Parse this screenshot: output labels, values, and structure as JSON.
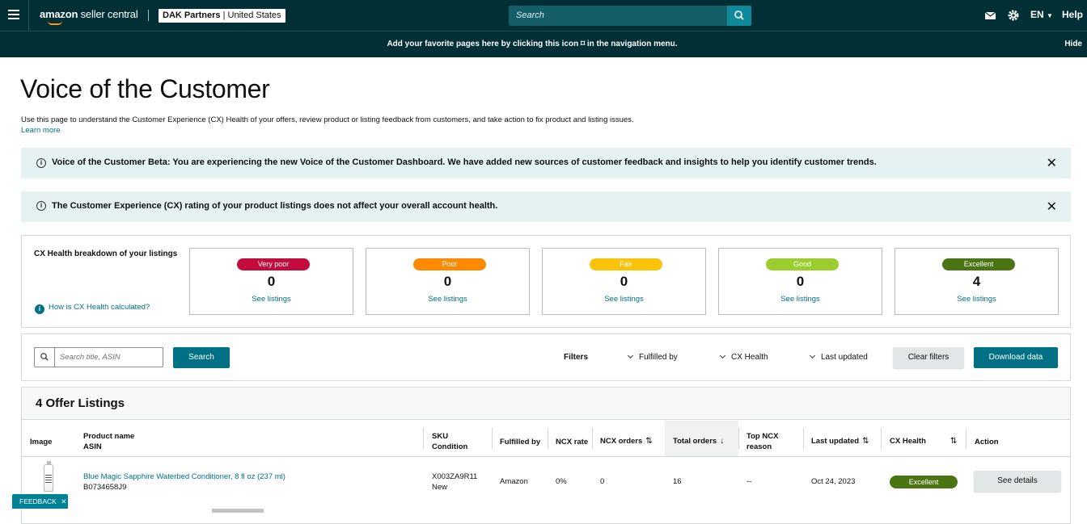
{
  "topbar": {
    "logo_bold": "amazon",
    "logo_light": "seller central",
    "account_name": "DAK Partners",
    "account_region": "United States",
    "search_placeholder": "Search",
    "language": "EN",
    "help": "Help",
    "icons": [
      "menu-icon",
      "search-icon",
      "mail-icon",
      "gear-icon",
      "caret-down-icon"
    ]
  },
  "favbar": {
    "message": "Add your favorite pages here by clicking this icon ⌑ in the navigation menu.",
    "hide": "Hide"
  },
  "page": {
    "title": "Voice of the Customer",
    "description": "Use this page to understand the Customer Experience (CX) Health of your offers, review product or listing feedback from customers, and take action to fix product and listing issues.",
    "learn_more": "Learn more"
  },
  "alerts": [
    {
      "text": "Voice of the Customer Beta: You are experiencing the new Voice of the Customer Dashboard. We have added new sources of customer feedback and insights to help you identify customer trends."
    },
    {
      "text": "The Customer Experience (CX) rating of your product listings does not affect your overall account health."
    }
  ],
  "cx_health": {
    "heading": "CX Health breakdown of your listings",
    "how_link": "How is CX Health calculated?",
    "cards": [
      {
        "label": "Very poor",
        "count": "0",
        "link": "See listings",
        "color": "#c40c3c"
      },
      {
        "label": "Poor",
        "count": "0",
        "link": "See listings",
        "color": "#ff8a00"
      },
      {
        "label": "Fair",
        "count": "0",
        "link": "See listings",
        "color": "#fcc30b"
      },
      {
        "label": "Good",
        "count": "0",
        "link": "See listings",
        "color": "#9ccd2e"
      },
      {
        "label": "Excellent",
        "count": "4",
        "link": "See listings",
        "color": "#4b7412"
      }
    ]
  },
  "filters": {
    "search_placeholder": "Search title, ASIN",
    "search_button": "Search",
    "filters_label": "Filters",
    "fulfilled_by": "Fulfilled by",
    "cx_health": "CX Health",
    "last_updated": "Last updated",
    "clear": "Clear filters",
    "download": "Download data"
  },
  "listings": {
    "title": "4 Offer Listings",
    "columns": {
      "image": "Image",
      "product_name": "Product name",
      "asin": "ASIN",
      "sku": "SKU",
      "condition": "Condition",
      "fulfilled_by": "Fulfilled by",
      "ncx_rate": "NCX rate",
      "ncx_orders": "NCX orders",
      "total_orders": "Total orders",
      "top_ncx": "Top NCX",
      "reason": "reason",
      "last_updated": "Last updated",
      "cx_health": "CX Health",
      "action": "Action"
    },
    "rows": [
      {
        "product_name": "Blue Magic Sapphire Waterbed Conditioner, 8 fl oz (237 ml)",
        "asin": "B0734658J9",
        "sku": "X003ZA9R11",
        "condition": "New",
        "fulfilled_by": "Amazon",
        "ncx_rate": "0%",
        "ncx_orders": "0",
        "total_orders": "16",
        "top_ncx_reason": "--",
        "last_updated": "Oct 24, 2023",
        "cx_health": "Excellent",
        "action": "See details"
      }
    ]
  },
  "feedback": "FEEDBACK"
}
